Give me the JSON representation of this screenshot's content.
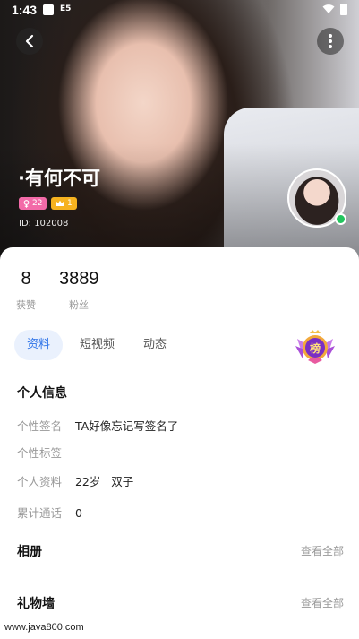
{
  "status_bar": {
    "time": "1:43",
    "sim_label": "E5"
  },
  "profile": {
    "name": "·有何不可",
    "gender_badge": {
      "icon": "female-icon",
      "value": "22"
    },
    "level_badge": {
      "icon": "crown-icon",
      "value": "1"
    },
    "id_label": "ID: 102008",
    "online": true
  },
  "stats": [
    {
      "value": "8",
      "label": "获赞"
    },
    {
      "value": "3889",
      "label": "粉丝"
    }
  ],
  "tabs": [
    {
      "label": "资料",
      "active": true
    },
    {
      "label": "短视频",
      "active": false
    },
    {
      "label": "动态",
      "active": false
    }
  ],
  "rank_badge": {
    "text": "榜"
  },
  "personal_info": {
    "title": "个人信息",
    "rows": [
      {
        "key": "个性签名",
        "value": "TA好像忘记写签名了"
      },
      {
        "key": "个性标签",
        "value": ""
      },
      {
        "key": "个人资料",
        "value": "22岁   双子"
      },
      {
        "key": "累计通话",
        "value": "0"
      }
    ]
  },
  "album": {
    "title": "相册",
    "see_all": "查看全部"
  },
  "gift_wall": {
    "title": "礼物墙",
    "see_all": "查看全部"
  },
  "watermark": "www.java800.com",
  "colors": {
    "accent": "#2f74e8",
    "tab_bg": "#eaf1fd",
    "online": "#22c55e",
    "gender": "#f36aa8",
    "level": "#f6b21f"
  }
}
